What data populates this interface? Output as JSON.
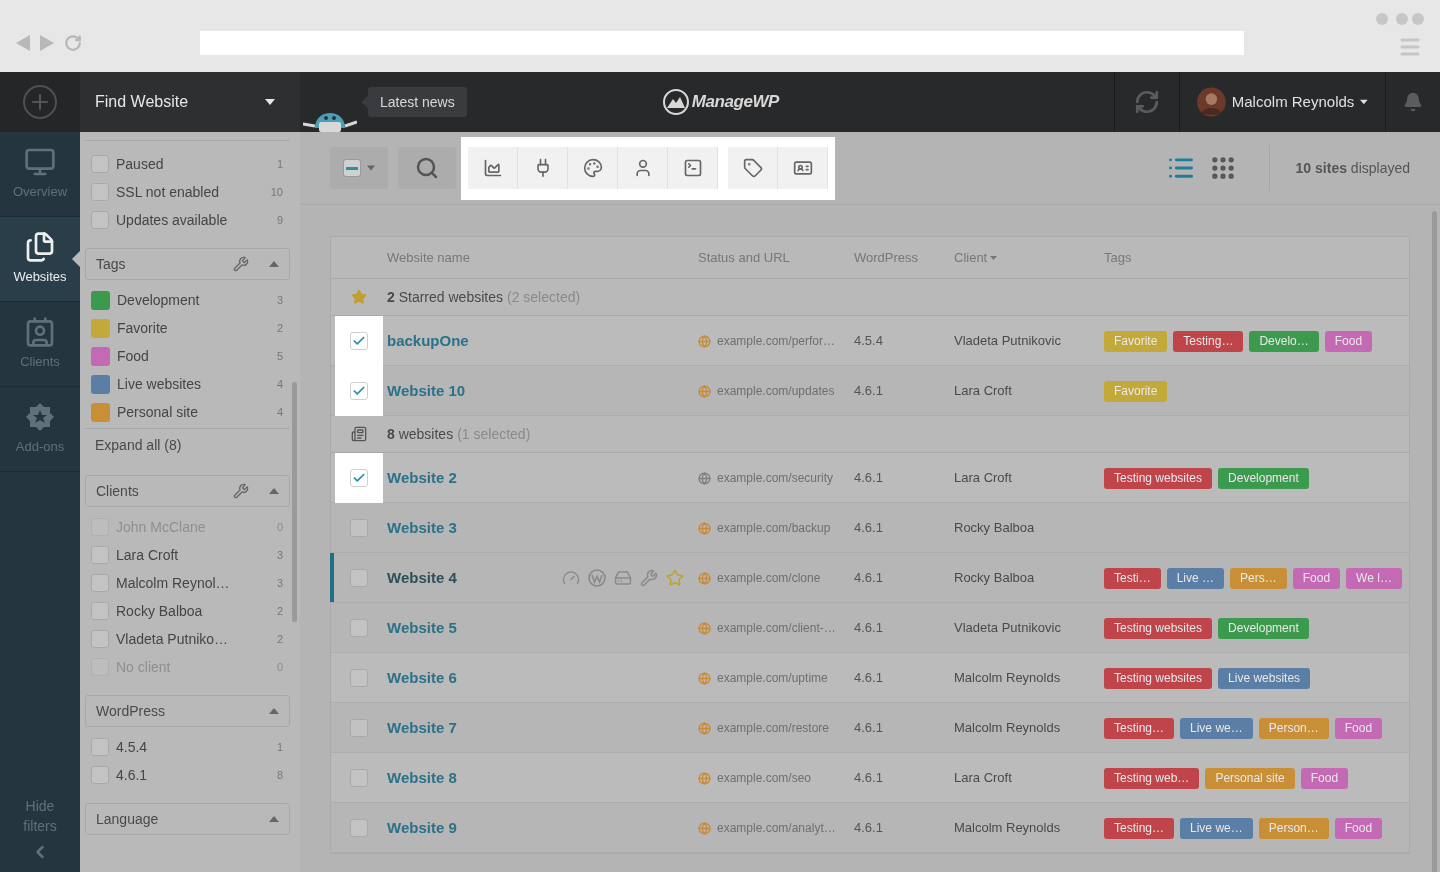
{
  "app": {
    "find_label": "Find Website",
    "news_label": "Latest news",
    "logo_text": "ManageWP",
    "user_name": "Malcolm Reynolds"
  },
  "nav": [
    {
      "kind": "overview",
      "label": "Overview",
      "selected": false
    },
    {
      "kind": "websites",
      "label": "Websites",
      "selected": true
    },
    {
      "kind": "clients",
      "label": "Clients",
      "selected": false
    },
    {
      "kind": "addons",
      "label": "Add-ons",
      "selected": false
    }
  ],
  "hide_filters": "Hide filters",
  "filters": {
    "status": [
      {
        "label": "Paused",
        "count": "1",
        "checked": false
      },
      {
        "label": "SSL not enabled",
        "count": "10",
        "checked": false
      },
      {
        "label": "Updates available",
        "count": "9",
        "checked": false
      }
    ],
    "sections": [
      {
        "kind": "tags",
        "title": "Tags",
        "wrench": true,
        "items": [
          {
            "label": "Development",
            "count": "3",
            "color": "#3c9a4e"
          },
          {
            "label": "Favorite",
            "count": "2",
            "color": "#c2a93a"
          },
          {
            "label": "Food",
            "count": "5",
            "color": "#c46ab4"
          },
          {
            "label": "Live websites",
            "count": "4",
            "color": "#5a7ea6"
          },
          {
            "label": "Personal site",
            "count": "4",
            "color": "#c98f37"
          }
        ],
        "expand": "Expand all (8)"
      },
      {
        "kind": "checks",
        "title": "Clients",
        "wrench": true,
        "items": [
          {
            "label": "John McClane",
            "count": "0",
            "checked": false,
            "disabled": true
          },
          {
            "label": "Lara Croft",
            "count": "3",
            "checked": false,
            "disabled": false
          },
          {
            "label": "Malcolm Reynol…",
            "count": "3",
            "checked": false,
            "disabled": false
          },
          {
            "label": "Rocky Balboa",
            "count": "2",
            "checked": false,
            "disabled": false
          },
          {
            "label": "Vladeta Putniko…",
            "count": "2",
            "checked": false,
            "disabled": false
          },
          {
            "label": "No client",
            "count": "0",
            "checked": false,
            "disabled": true
          }
        ]
      },
      {
        "kind": "checks",
        "title": "WordPress",
        "wrench": false,
        "items": [
          {
            "label": "4.5.4",
            "count": "1",
            "checked": false,
            "disabled": false
          },
          {
            "label": "4.6.1",
            "count": "8",
            "checked": false,
            "disabled": false
          }
        ]
      },
      {
        "title": "Language",
        "wrench": false
      }
    ]
  },
  "toolbar": {
    "views": [
      {
        "kind": "list",
        "selected": true
      },
      {
        "kind": "grid",
        "selected": false
      }
    ],
    "sites_displayed": "**10 sites** displayed"
  },
  "table": {
    "columns": [
      "Website name",
      "Status and URL",
      "WordPress",
      "Client",
      "Tags"
    ],
    "groups": [
      {
        "kind": "starred",
        "title": "**2** Starred websites",
        "selected_note": "(2 selected)",
        "rows": [
          {
            "name": "backupOne",
            "url": "example.com/perfor…",
            "status": {
              "color": "#c98a3a"
            },
            "wp": "4.5.4",
            "client": "Vladeta Putnikovic",
            "checked": true,
            "hovered": false,
            "tags": [
              {
                "label": "Favorite",
                "color": "#c2a93a"
              },
              {
                "label": "Testing…",
                "color": "#c0454a"
              },
              {
                "label": "Develo…",
                "color": "#3c9a4e"
              },
              {
                "label": "Food",
                "color": "#c46ab4"
              }
            ]
          },
          {
            "name": "Website 10",
            "url": "example.com/updates",
            "status": {
              "color": "#c98a3a"
            },
            "wp": "4.6.1",
            "client": "Lara Croft",
            "checked": true,
            "hovered": false,
            "tags": [
              {
                "label": "Favorite",
                "color": "#c2a93a"
              }
            ]
          }
        ]
      },
      {
        "kind": "all",
        "title": "**8** websites",
        "selected_note": "(1 selected)",
        "rows": [
          {
            "name": "Website 2",
            "url": "example.com/security",
            "status": {
              "color": "#808080"
            },
            "wp": "4.6.1",
            "client": "Lara Croft",
            "checked": true,
            "hovered": false,
            "tags": [
              {
                "label": "Testing websites",
                "color": "#c0454a"
              },
              {
                "label": "Development",
                "color": "#3c9a4e"
              }
            ]
          },
          {
            "name": "Website 3",
            "url": "example.com/backup",
            "status": {
              "color": "#c98a3a"
            },
            "wp": "4.6.1",
            "client": "Rocky Balboa",
            "checked": false,
            "hovered": false
          },
          {
            "name": "Website 4",
            "url": "example.com/clone",
            "status": {
              "color": "#c98a3a"
            },
            "wp": "4.6.1",
            "client": "Rocky Balboa",
            "checked": false,
            "hovered": true,
            "tags": [
              {
                "label": "Testi…",
                "color": "#c0454a"
              },
              {
                "label": "Live …",
                "color": "#5a7ea6"
              },
              {
                "label": "Pers…",
                "color": "#c98f37"
              },
              {
                "label": "Food",
                "color": "#c46ab4"
              },
              {
                "label": "We l…",
                "color": "#c46ab4"
              }
            ]
          },
          {
            "name": "Website 5",
            "url": "example.com/client-…",
            "status": {
              "color": "#c98a3a"
            },
            "wp": "4.6.1",
            "client": "Vladeta Putnikovic",
            "checked": false,
            "hovered": false,
            "tags": [
              {
                "label": "Testing websites",
                "color": "#c0454a"
              },
              {
                "label": "Development",
                "color": "#3c9a4e"
              }
            ]
          },
          {
            "name": "Website 6",
            "url": "example.com/uptime",
            "status": {
              "color": "#c98a3a"
            },
            "wp": "4.6.1",
            "client": "Malcolm Reynolds",
            "checked": false,
            "hovered": false,
            "tags": [
              {
                "label": "Testing websites",
                "color": "#c0454a"
              },
              {
                "label": "Live websites",
                "color": "#5a7ea6"
              }
            ]
          },
          {
            "name": "Website 7",
            "url": "example.com/restore",
            "status": {
              "color": "#c98a3a"
            },
            "wp": "4.6.1",
            "client": "Malcolm Reynolds",
            "checked": false,
            "hovered": false,
            "tags": [
              {
                "label": "Testing…",
                "color": "#c0454a"
              },
              {
                "label": "Live we…",
                "color": "#5a7ea6"
              },
              {
                "label": "Person…",
                "color": "#c98f37"
              },
              {
                "label": "Food",
                "color": "#c46ab4"
              }
            ]
          },
          {
            "name": "Website 8",
            "url": "example.com/seo",
            "status": {
              "color": "#c98a3a"
            },
            "wp": "4.6.1",
            "client": "Lara Croft",
            "checked": false,
            "hovered": false,
            "tags": [
              {
                "label": "Testing web…",
                "color": "#c0454a"
              },
              {
                "label": "Personal site",
                "color": "#c98f37"
              },
              {
                "label": "Food",
                "color": "#c46ab4"
              }
            ]
          },
          {
            "name": "Website 9",
            "url": "example.com/analyt…",
            "status": {
              "color": "#c98a3a"
            },
            "wp": "4.6.1",
            "client": "Malcolm Reynolds",
            "checked": false,
            "hovered": false,
            "tags": [
              {
                "label": "Testing…",
                "color": "#c0454a"
              },
              {
                "label": "Live we…",
                "color": "#5a7ea6"
              },
              {
                "label": "Person…",
                "color": "#c98f37"
              },
              {
                "label": "Food",
                "color": "#c46ab4"
              }
            ]
          }
        ]
      }
    ]
  }
}
